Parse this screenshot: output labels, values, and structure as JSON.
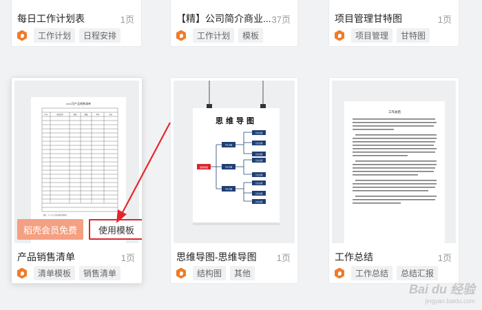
{
  "cards_top": [
    {
      "title": "每日工作计划表",
      "pages": "1页",
      "tags": [
        "工作计划",
        "日程安排"
      ]
    },
    {
      "title": "【精】公司简介商业...",
      "pages": "37页",
      "tags": [
        "工作计划",
        "模板"
      ]
    },
    {
      "title": "项目管理甘特图",
      "pages": "1页",
      "tags": [
        "项目管理",
        "甘特图"
      ]
    }
  ],
  "cards_bottom": [
    {
      "title": "产品销售清单",
      "pages": "1页",
      "tags": [
        "清单模板",
        "销售清单"
      ],
      "vip_button": "稻壳会员免费",
      "use_button": "使用模板",
      "doc_title": "xx公司产品销售清单",
      "doc_cols": [
        "序号",
        "商品名称",
        "规格",
        "数量",
        "单价",
        "总价"
      ],
      "doc_footer": "备注：1. 以上产品价格仅供参考。"
    },
    {
      "title": "思维导图-思维导图",
      "pages": "1页",
      "tags": [
        "结构图",
        "其他"
      ],
      "mindmap_title": "思维导图",
      "root_label": "思维导图",
      "branch_label": "中心主题",
      "leaf_label": "分支主题"
    },
    {
      "title": "工作总结",
      "pages": "1页",
      "tags": [
        "工作总结",
        "总结汇报"
      ],
      "doc_title": "工作总结"
    }
  ],
  "watermark": {
    "main": "Bai du 经验",
    "sub": "jingyan.baidu.com"
  },
  "colors": {
    "accent_red": "#d9252c",
    "vip": "#f4a082",
    "brand_orange": "#ef7b2b",
    "node_blue": "#1f3f73",
    "root_red": "#d9252c"
  }
}
